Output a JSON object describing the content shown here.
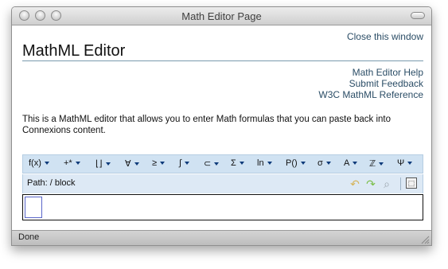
{
  "window": {
    "title": "Math Editor Page"
  },
  "header": {
    "close_link": "Close this window",
    "page_title": "MathML Editor"
  },
  "help_links": [
    "Math Editor Help",
    "Submit Feedback",
    "W3C MathML Reference"
  ],
  "description": "This is a MathML editor that allows you to enter Math formulas that you can paste back into Connexions content.",
  "math_toolbar": {
    "buttons": [
      {
        "label": "f(x)",
        "icon": "function-icon"
      },
      {
        "label": "+*",
        "icon": "operators-icon"
      },
      {
        "label": "⌊⌋",
        "icon": "floor-icon"
      },
      {
        "label": "∀",
        "icon": "forall-icon"
      },
      {
        "label": "≥",
        "icon": "relations-icon"
      },
      {
        "label": "∫",
        "icon": "integral-icon"
      },
      {
        "label": "⊂",
        "icon": "subset-icon"
      },
      {
        "label": "Σ",
        "icon": "sum-icon"
      },
      {
        "label": "ln",
        "icon": "log-icon"
      },
      {
        "label": "P()",
        "icon": "probability-icon"
      },
      {
        "label": "σ",
        "icon": "statistics-icon"
      },
      {
        "label": "A",
        "icon": "matrix-icon"
      },
      {
        "label": "ℤ",
        "icon": "number-sets-icon"
      },
      {
        "label": "Ψ",
        "icon": "greek-icon"
      }
    ]
  },
  "path_bar": {
    "path": "Path: / block",
    "icons": [
      "undo-icon",
      "redo-icon",
      "preview-icon",
      "expand-icon"
    ]
  },
  "status": {
    "text": "Done"
  },
  "colors": {
    "link": "#2b4d66",
    "toolbar_bg": "#d0e2f2",
    "path_bg": "#dde9f5",
    "caret": "#0d3a7a"
  }
}
